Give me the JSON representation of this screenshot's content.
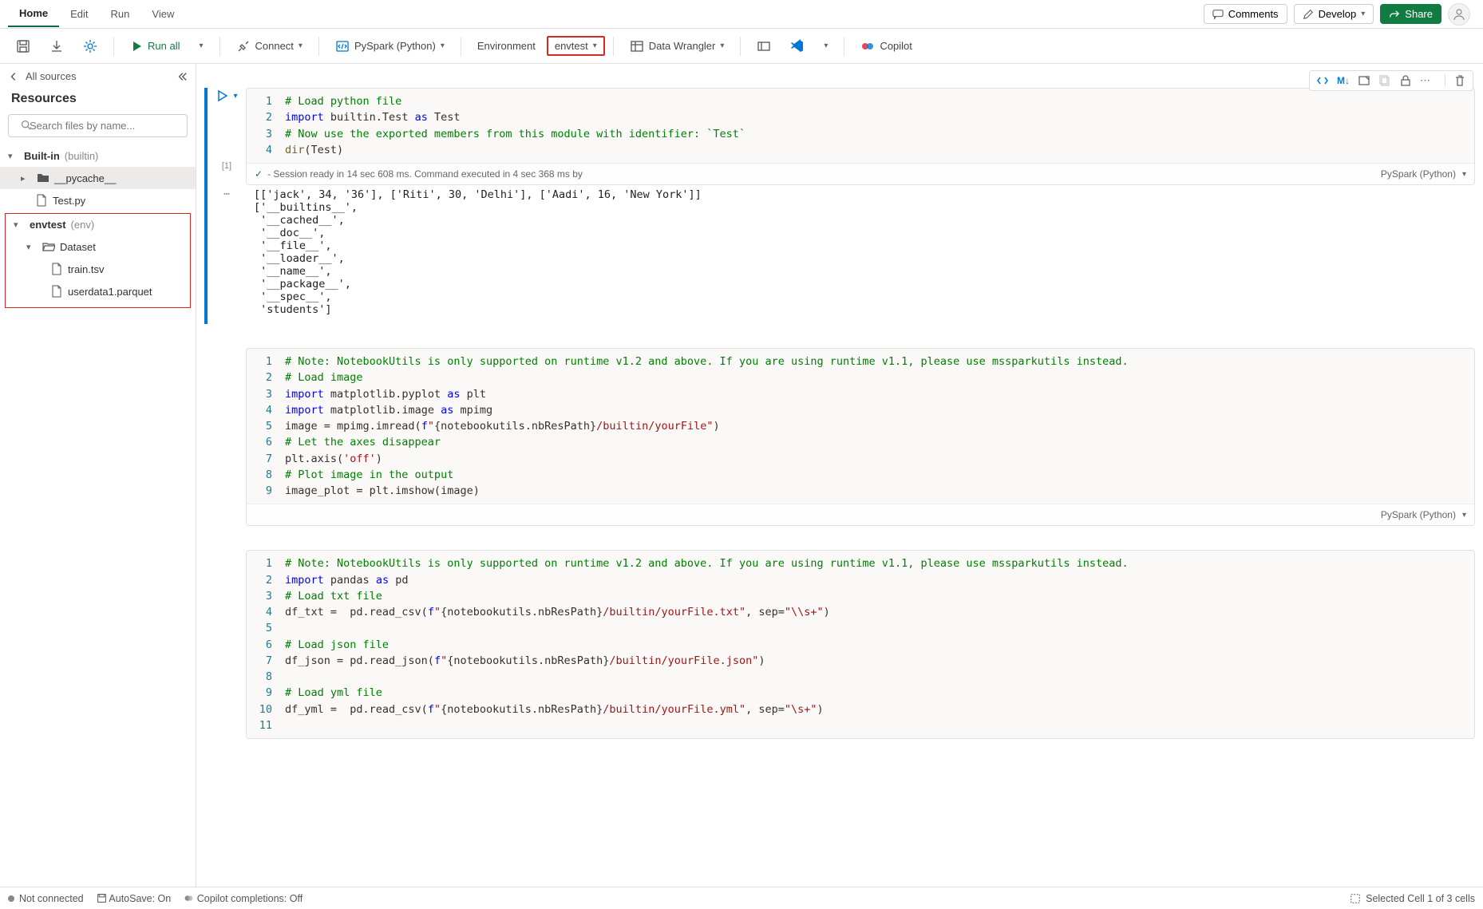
{
  "tabs": {
    "home": "Home",
    "edit": "Edit",
    "run": "Run",
    "view": "View"
  },
  "topRight": {
    "comments": "Comments",
    "develop": "Develop",
    "share": "Share"
  },
  "toolbar": {
    "runAll": "Run all",
    "connect": "Connect",
    "pyspark": "PySpark (Python)",
    "environment": "Environment",
    "envtest": "envtest",
    "dataWrangler": "Data Wrangler",
    "copilot": "Copilot"
  },
  "sidebar": {
    "allSources": "All sources",
    "title": "Resources",
    "searchPlaceholder": "Search files by name...",
    "builtin": {
      "label": "Built-in",
      "suffix": "(builtin)"
    },
    "pycache": "__pycache__",
    "testpy": "Test.py",
    "envtest": {
      "label": "envtest",
      "suffix": "(env)"
    },
    "dataset": "Dataset",
    "train": "train.tsv",
    "userdata": "userdata1.parquet"
  },
  "cell1": {
    "execCount": "[1]",
    "lines": [
      {
        "n": "1",
        "html": "<span class='c-comment'># Load python file</span>"
      },
      {
        "n": "2",
        "html": "<span class='c-keyword'>import</span> builtin.Test <span class='c-keyword'>as</span> Test"
      },
      {
        "n": "3",
        "html": "<span class='c-comment'># Now use the exported members from this module with identifier: `Test`</span>"
      },
      {
        "n": "4",
        "html": "<span class='c-func'>dir</span>(Test)"
      }
    ],
    "status": "- Session ready in 14 sec 608 ms. Command executed in 4 sec 368 ms by",
    "lang": "PySpark (Python)",
    "output": "[['jack', 34, '36'], ['Riti', 30, 'Delhi'], ['Aadi', 16, 'New York']]\n['__builtins__',\n '__cached__',\n '__doc__',\n '__file__',\n '__loader__',\n '__name__',\n '__package__',\n '__spec__',\n 'students']"
  },
  "cell2": {
    "lines": [
      {
        "n": "1",
        "html": "<span class='c-comment'># Note: NotebookUtils is only supported on runtime v1.2 and above. If you are using runtime v1.1, please use mssparkutils instead.</span>"
      },
      {
        "n": "2",
        "html": "<span class='c-comment'># Load image</span>"
      },
      {
        "n": "3",
        "html": "<span class='c-keyword'>import</span> matplotlib.pyplot <span class='c-keyword'>as</span> plt"
      },
      {
        "n": "4",
        "html": "<span class='c-keyword'>import</span> matplotlib.image <span class='c-keyword'>as</span> mpimg"
      },
      {
        "n": "5",
        "html": "image = mpimg.imread(<span class='c-keyword'>f</span><span class='c-str'>\"</span>{notebookutils.nbResPath}<span class='c-str'>/builtin/yourFile\"</span>)"
      },
      {
        "n": "6",
        "html": "<span class='c-comment'># Let the axes disappear</span>"
      },
      {
        "n": "7",
        "html": "plt.axis(<span class='c-str'>'off'</span>)"
      },
      {
        "n": "8",
        "html": "<span class='c-comment'># Plot image in the output</span>"
      },
      {
        "n": "9",
        "html": "image_plot = plt.imshow(image)"
      }
    ],
    "lang": "PySpark (Python)"
  },
  "cell3": {
    "lines": [
      {
        "n": "1",
        "html": "<span class='c-comment'># Note: NotebookUtils is only supported on runtime v1.2 and above. If you are using runtime v1.1, please use mssparkutils instead.</span>"
      },
      {
        "n": "2",
        "html": "<span class='c-keyword'>import</span> pandas <span class='c-keyword'>as</span> pd"
      },
      {
        "n": "3",
        "html": "<span class='c-comment'># Load txt file</span>"
      },
      {
        "n": "4",
        "html": "df_txt =  pd.read_csv(<span class='c-keyword'>f</span><span class='c-str'>\"</span>{notebookutils.nbResPath}<span class='c-str'>/builtin/yourFile.txt\"</span>, sep=<span class='c-str'>\"\\\\s+\"</span>)"
      },
      {
        "n": "5",
        "html": ""
      },
      {
        "n": "6",
        "html": "<span class='c-comment'># Load json file</span>"
      },
      {
        "n": "7",
        "html": "df_json = pd.read_json(<span class='c-keyword'>f</span><span class='c-str'>\"</span>{notebookutils.nbResPath}<span class='c-str'>/builtin/yourFile.json\"</span>)"
      },
      {
        "n": "8",
        "html": ""
      },
      {
        "n": "9",
        "html": "<span class='c-comment'># Load yml file</span>"
      },
      {
        "n": "10",
        "html": "df_yml =  pd.read_csv(<span class='c-keyword'>f</span><span class='c-str'>\"</span>{notebookutils.nbResPath}<span class='c-str'>/builtin/yourFile.yml\"</span>, sep=<span class='c-str'>\"\\s+\"</span>)"
      },
      {
        "n": "11",
        "html": ""
      }
    ]
  },
  "nbToolbar": {
    "md": "M↓"
  },
  "statusbar": {
    "notConnected": "Not connected",
    "autosave": "AutoSave: On",
    "copilot": "Copilot completions: Off",
    "selected": "Selected Cell 1 of 3 cells"
  }
}
